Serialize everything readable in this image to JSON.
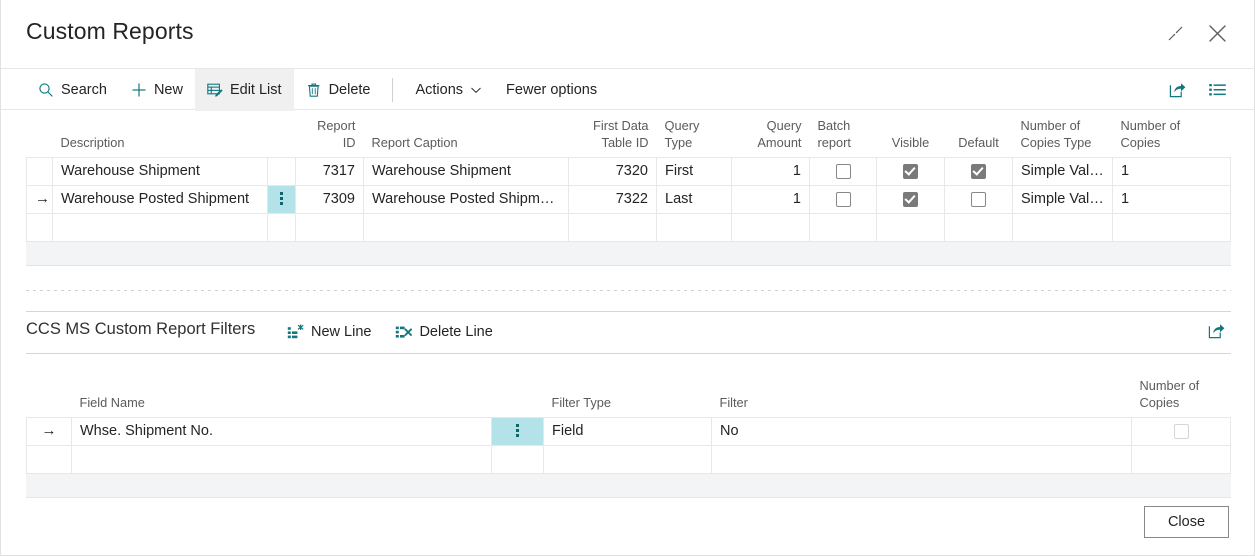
{
  "window": {
    "title": "Custom Reports",
    "minimize_icon": "shrink-icon",
    "close_icon": "close-icon"
  },
  "toolbar": {
    "items": [
      {
        "label": "Search",
        "icon": "search-icon",
        "active": false
      },
      {
        "label": "New",
        "icon": "plus-icon",
        "active": false
      },
      {
        "label": "Edit List",
        "icon": "edit-list-icon",
        "active": true
      },
      {
        "label": "Delete",
        "icon": "trash-icon",
        "active": false
      }
    ],
    "actions_label": "Actions",
    "actions_icon": "chevron-down-icon",
    "fewer_options_label": "Fewer options",
    "share_icon": "share-icon",
    "list_view_icon": "list-view-icon"
  },
  "main_grid": {
    "columns": [
      {
        "label": "Description",
        "align": "left"
      },
      {
        "label": "",
        "align": "center"
      },
      {
        "label": "Report ID",
        "align": "right"
      },
      {
        "label": "Report Caption",
        "align": "left"
      },
      {
        "label": "First Data Table ID",
        "align": "right"
      },
      {
        "label": "Query Type",
        "align": "left"
      },
      {
        "label": "Query Amount",
        "align": "right"
      },
      {
        "label": "Batch report",
        "align": "center"
      },
      {
        "label": "Visible",
        "align": "center"
      },
      {
        "label": "Default",
        "align": "center"
      },
      {
        "label": "Number of Copies Type",
        "align": "left"
      },
      {
        "label": "Number of Copies",
        "align": "left"
      }
    ],
    "rows": [
      {
        "selected": false,
        "description": "Warehouse Shipment",
        "report_id": "7317",
        "report_caption": "Warehouse Shipment",
        "first_data_table_id": "7320",
        "query_type": "First",
        "query_amount": "1",
        "batch_report": false,
        "visible": true,
        "default": true,
        "number_of_copies_type": "Simple Value",
        "number_of_copies": "1"
      },
      {
        "selected": true,
        "description": "Warehouse Posted Shipment",
        "report_id": "7309",
        "report_caption": "Warehouse Posted Shipment",
        "first_data_table_id": "7322",
        "query_type": "Last",
        "query_amount": "1",
        "batch_report": false,
        "visible": true,
        "default": false,
        "number_of_copies_type": "Simple Value",
        "number_of_copies": "1"
      }
    ]
  },
  "subpart": {
    "title": "CCS MS Custom Report Filters",
    "new_line_label": "New Line",
    "new_line_icon": "new-line-icon",
    "delete_line_label": "Delete Line",
    "delete_line_icon": "delete-line-icon",
    "share_icon": "share-icon",
    "columns": [
      {
        "label": "Field Name",
        "align": "left"
      },
      {
        "label": "",
        "align": "center"
      },
      {
        "label": "Filter Type",
        "align": "left"
      },
      {
        "label": "Filter",
        "align": "left"
      },
      {
        "label": "Number of Copies",
        "align": "center"
      }
    ],
    "rows": [
      {
        "selected": true,
        "field_name": "Whse. Shipment No.",
        "filter_type": "Field",
        "filter": "No",
        "number_of_copies": false
      }
    ]
  },
  "footer": {
    "close_label": "Close"
  },
  "colors": {
    "accent_teal": "#11777f",
    "selected_cell": "#b3e2e8",
    "checkbox_on": "#7a7a7a",
    "grid_line": "#e8e8e8",
    "footer_strip": "#f3f4f6"
  }
}
